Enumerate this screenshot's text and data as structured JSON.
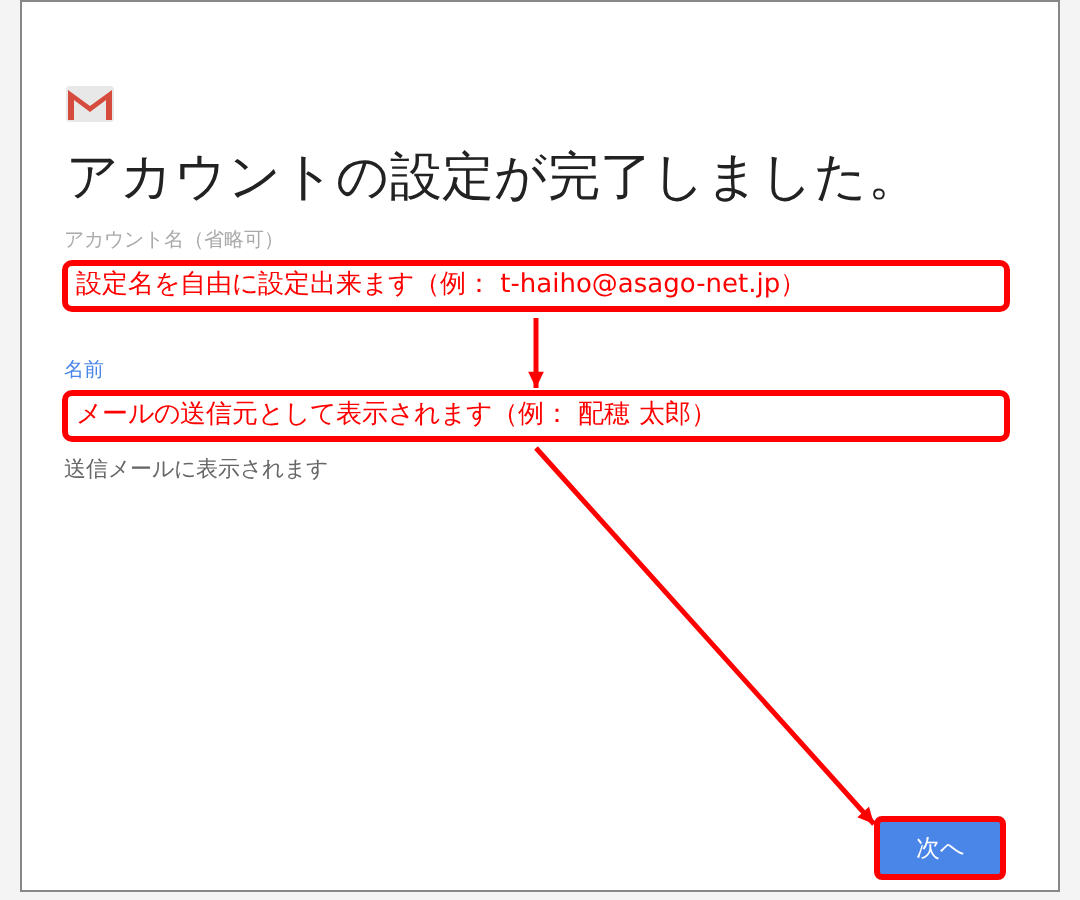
{
  "title": "アカウントの設定が完了しました。",
  "fields": [
    {
      "label": "アカウント名（省略可）",
      "active": false,
      "callout": "設定名を自由に設定出来ます（例： t-haiho@asago-net.jp）"
    },
    {
      "label": "名前",
      "active": true,
      "callout": "メールの送信元として表示されます（例： 配穂 太郎）",
      "helper": "送信メールに表示されます"
    }
  ],
  "next_button": {
    "label": "次へ",
    "highlighted": true
  }
}
